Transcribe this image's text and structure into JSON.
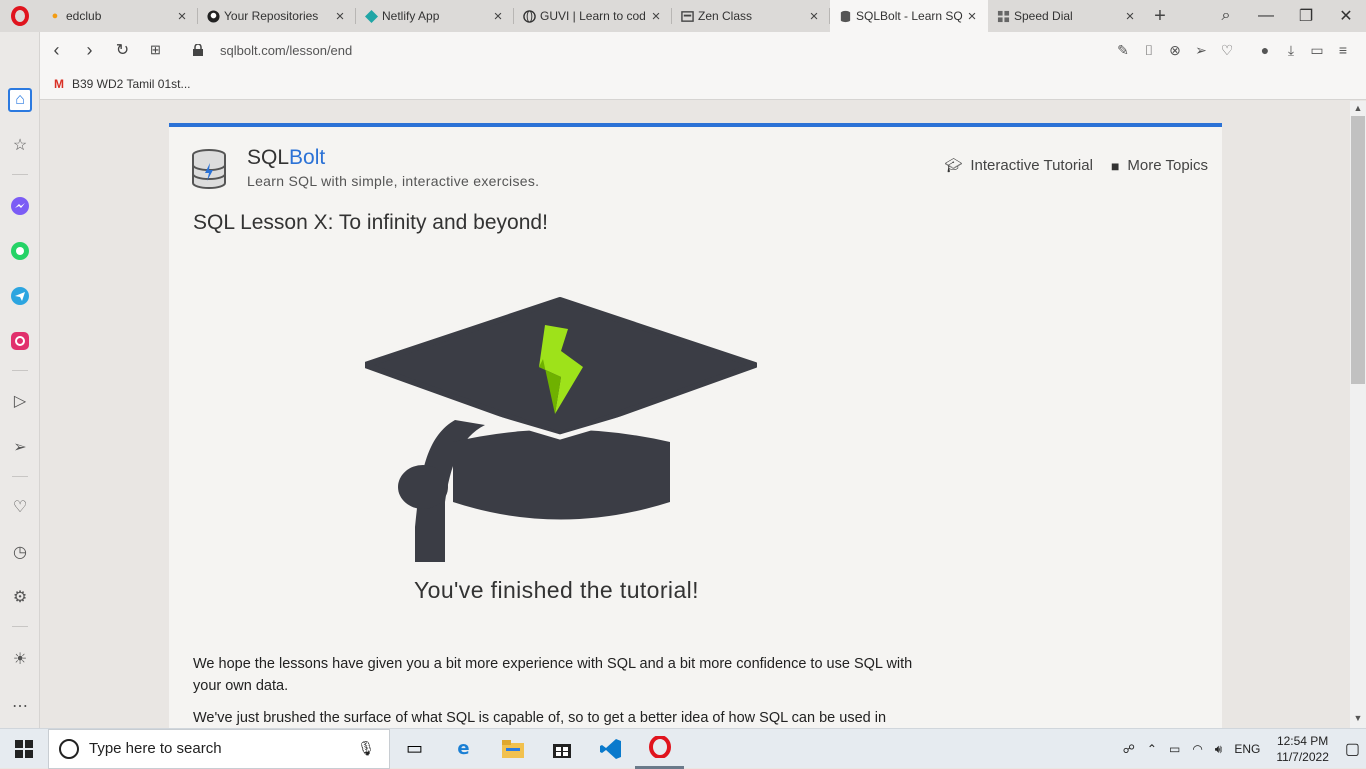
{
  "browser": {
    "tabs": [
      {
        "title": "edclub",
        "icon": "edclub-icon"
      },
      {
        "title": "Your Repositories",
        "icon": "github-icon"
      },
      {
        "title": "Netlify App",
        "icon": "netlify-icon"
      },
      {
        "title": "GUVI | Learn to cod",
        "icon": "globe-icon"
      },
      {
        "title": "Zen Class",
        "icon": "page-icon"
      },
      {
        "title": "SQLBolt - Learn SQ",
        "icon": "sqlbolt-icon",
        "active": true
      },
      {
        "title": "Speed Dial",
        "icon": "speed-dial-icon"
      }
    ],
    "url": "sqlbolt.com/lesson/end",
    "bookmark": "B39 WD2 Tamil 01st..."
  },
  "page": {
    "brand_sql": "SQL",
    "brand_bolt": "Bolt",
    "tagline": "Learn SQL with simple, interactive exercises.",
    "nav_tutorial": "Interactive Tutorial",
    "nav_topics": "More Topics",
    "lesson_title": "SQL Lesson X: To infinity and beyond!",
    "finished": "You've finished the tutorial!",
    "para1": "We hope the lessons have given you a bit more experience with SQL and a bit more confidence to use SQL with your own data.",
    "para2": "We've just brushed the surface of what SQL is capable of, so to get a better idea of how SQL can be used in"
  },
  "taskbar": {
    "search_placeholder": "Type here to search",
    "lang": "ENG",
    "time": "12:54 PM",
    "date": "11/7/2022"
  },
  "colors": {
    "accent": "#2b72d6",
    "bolt_green": "#9ee21a",
    "cap": "#3b3d45"
  }
}
